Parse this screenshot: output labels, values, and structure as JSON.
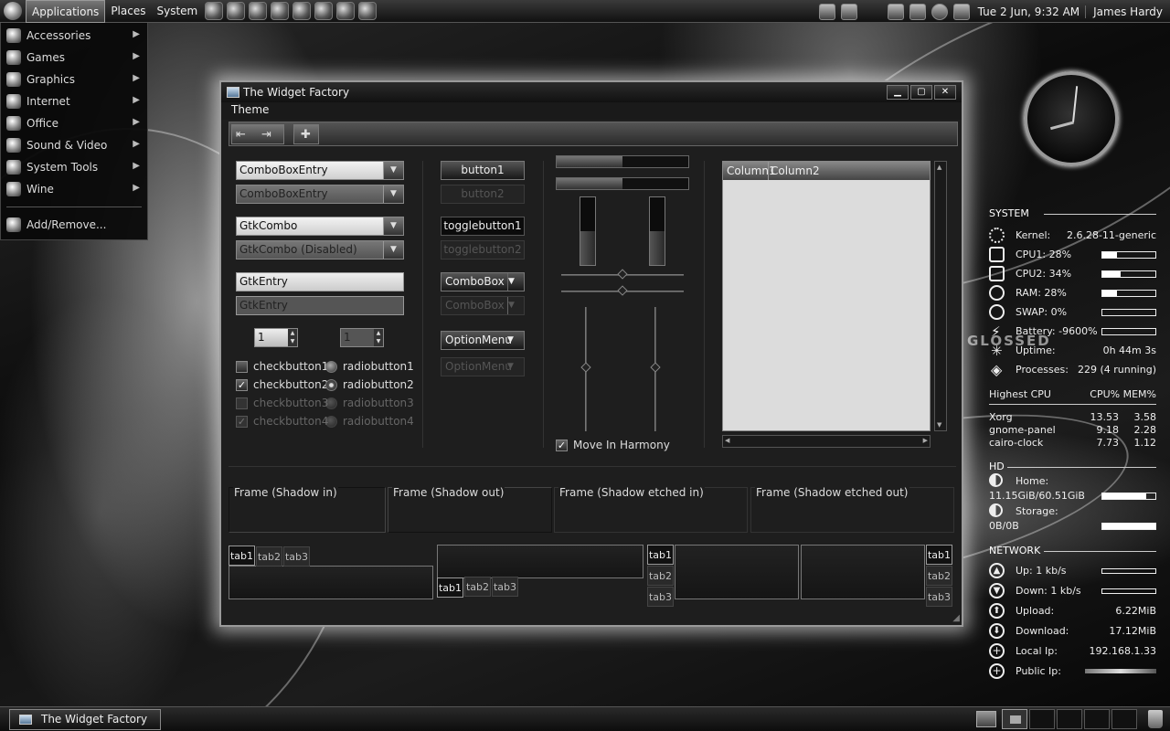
{
  "panel": {
    "menus": [
      "Applications",
      "Places",
      "System"
    ],
    "datetime": "Tue  2 Jun,  9:32 AM",
    "user": "James Hardy"
  },
  "apps_menu": {
    "items": [
      "Accessories",
      "Games",
      "Graphics",
      "Internet",
      "Office",
      "Sound & Video",
      "System Tools",
      "Wine"
    ],
    "add_remove": "Add/Remove..."
  },
  "window": {
    "title": "The Widget Factory",
    "menu": [
      "Theme"
    ],
    "combos": {
      "combo_entry": "ComboBoxEntry",
      "combo_entry_dis": "ComboBoxEntry",
      "gtkcombo": "GtkCombo",
      "gtkcombo_dis": "GtkCombo (Disabled)"
    },
    "entries": {
      "entry": "GtkEntry",
      "entry_dis": "GtkEntry"
    },
    "spins": {
      "spin": "1",
      "spin_dis": "1"
    },
    "checks": [
      "checkbutton1",
      "checkbutton2",
      "checkbutton3",
      "checkbutton4"
    ],
    "radios": [
      "radiobutton1",
      "radiobutton2",
      "radiobutton3",
      "radiobutton4"
    ],
    "buttons": {
      "button1": "button1",
      "button2": "button2",
      "toggle1": "togglebutton1",
      "toggle2": "togglebutton2",
      "combobox": "ComboBox",
      "combobox_dis": "ComboBox",
      "optionmenu": "OptionMenu",
      "optionmenu_dis": "OptionMenu"
    },
    "progress": {
      "h1": 0.5,
      "h2": 0.5,
      "v1": 0.5,
      "v2": 0.5
    },
    "harmony": "Move In Harmony",
    "tree_columns": [
      "Column1",
      "Column2"
    ],
    "frames": [
      "Frame (Shadow in)",
      "Frame (Shadow out)",
      "Frame (Shadow etched in)",
      "Frame (Shadow etched out)"
    ],
    "tabs": [
      "tab1",
      "tab2",
      "tab3"
    ]
  },
  "conky": {
    "system_title": "SYSTEM",
    "kernel_label": "Kernel:",
    "kernel": "2.6.28-11-generic",
    "cpu1": "CPU1: 28%",
    "cpu2": "CPU2: 34%",
    "ram": "RAM: 28%",
    "swap": "SWAP: 0%",
    "battery": "Battery: -9600%",
    "uptime_label": "Uptime:",
    "uptime": "0h 44m 3s",
    "processes_label": "Processes:",
    "processes": "229 (4 running)",
    "cpu1_pct": 0.28,
    "cpu2_pct": 0.34,
    "ram_pct": 0.28,
    "swap_pct": 0,
    "battery_pct": 0,
    "highest_cpu": "Highest CPU",
    "cpu_mem": "CPU% MEM%",
    "procs": [
      {
        "name": "Xorg",
        "cpu": "13.53",
        "mem": "3.58"
      },
      {
        "name": "gnome-panel",
        "cpu": "9.18",
        "mem": "2.28"
      },
      {
        "name": "cairo-clock",
        "cpu": "7.73",
        "mem": "1.12"
      }
    ],
    "hd_title": "HD",
    "home_label": "Home:",
    "home": "11.15GiB/60.51GiB",
    "home_pct": 0.82,
    "storage_label": "Storage:",
    "storage": "0B/0B",
    "storage_pct": 1,
    "net_title": "NETWORK",
    "up": "Up: 1 kb/s",
    "down": "Down: 1 kb/s",
    "upload_label": "Upload:",
    "upload": "6.22MiB",
    "download_label": "Download:",
    "download": "17.12MiB",
    "localip_label": "Local Ip:",
    "localip": "192.168.1.33",
    "publicip_label": "Public Ip:",
    "watermark": "GLOSSED"
  },
  "taskbar": {
    "task": "The Widget Factory"
  }
}
